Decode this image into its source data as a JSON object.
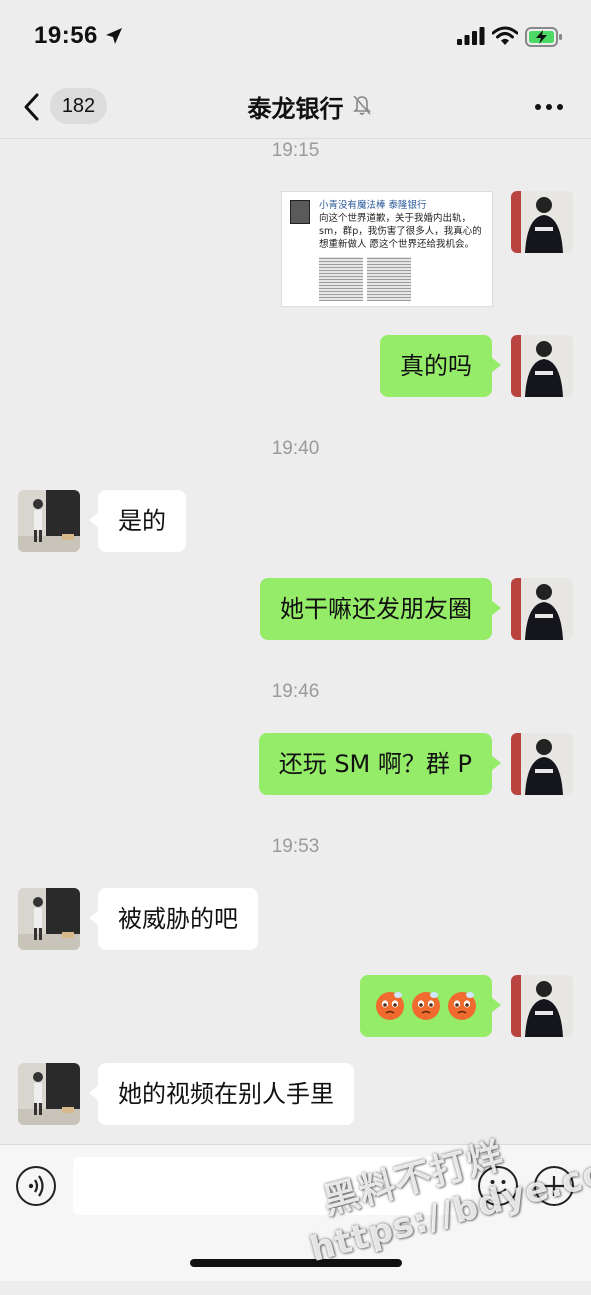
{
  "status_bar": {
    "time": "19:56"
  },
  "nav": {
    "unread_count": "182",
    "title": "泰龙银行"
  },
  "messages": [
    {
      "type": "timestamp",
      "text": "19:15"
    },
    {
      "type": "image",
      "from": "me",
      "image": {
        "header": "小青没有魔法棒 泰隆银行",
        "body": "向这个世界道歉，关于我婚内出轨，sm，群p，我伤害了很多人，我真心的想重新做人 愿这个世界还给我机会。"
      }
    },
    {
      "type": "text",
      "from": "me",
      "text": "真的吗"
    },
    {
      "type": "timestamp",
      "text": "19:40"
    },
    {
      "type": "text",
      "from": "other",
      "text": "是的"
    },
    {
      "type": "text",
      "from": "me",
      "text": "她干嘛还发朋友圈"
    },
    {
      "type": "timestamp",
      "text": "19:46"
    },
    {
      "type": "text",
      "from": "me",
      "text": "还玩 SM 啊？群 P"
    },
    {
      "type": "timestamp",
      "text": "19:53"
    },
    {
      "type": "text",
      "from": "other",
      "text": "被威胁的吧"
    },
    {
      "type": "emoji",
      "from": "me",
      "icons": [
        "blush-emoji",
        "blush-emoji",
        "blush-emoji"
      ]
    },
    {
      "type": "text",
      "from": "other",
      "text": "她的视频在别人手里"
    }
  ],
  "input_bar": {
    "value": ""
  },
  "watermark": {
    "line1": "黑料不打烊",
    "line2": "https://bdye.co"
  },
  "colors": {
    "my_bubble": "#95ec69",
    "their_bubble": "#ffffff",
    "background": "#ededed"
  }
}
